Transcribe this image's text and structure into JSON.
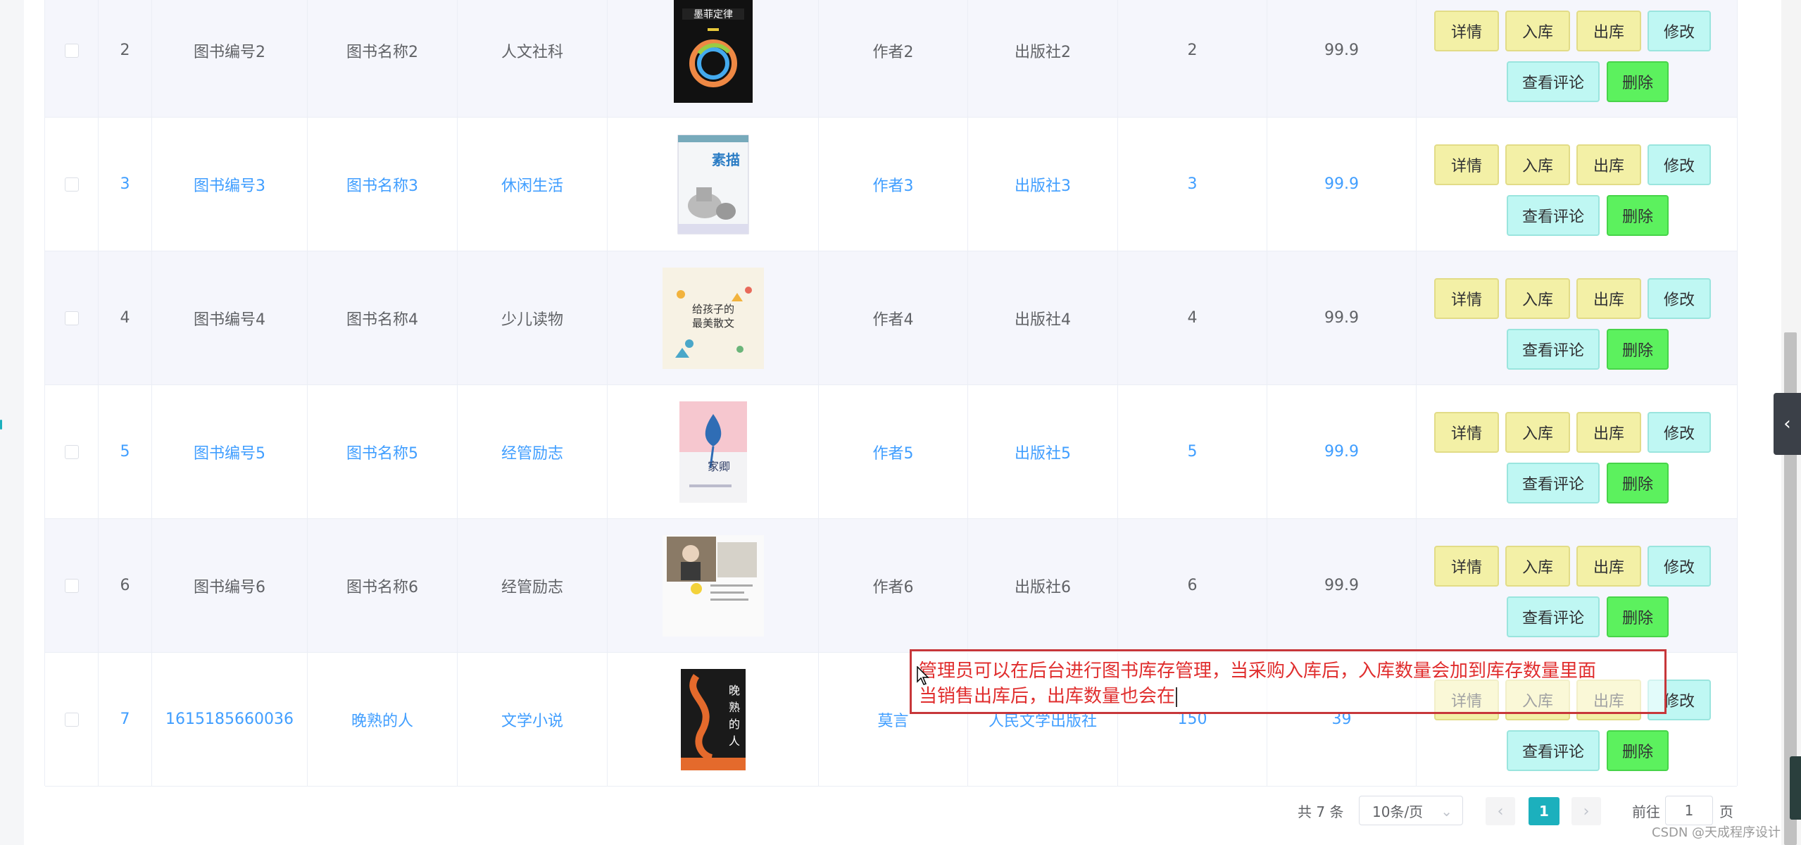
{
  "columns": [
    "checkbox",
    "index",
    "book_no",
    "book_name",
    "category",
    "cover",
    "author",
    "publisher",
    "quantity",
    "price",
    "actions"
  ],
  "actions": {
    "detail": "详情",
    "stock_in": "入库",
    "stock_out": "出库",
    "edit": "修改",
    "comments": "查看评论",
    "delete": "删除"
  },
  "rows": [
    {
      "index": "2",
      "book_no": "图书编号2",
      "book_name": "图书名称2",
      "category": "人文社科",
      "cover": "cover-moores-law",
      "cover_title": "墨菲定律",
      "author": "作者2",
      "publisher": "出版社2",
      "quantity": "2",
      "price": "99.9",
      "highlight": false
    },
    {
      "index": "3",
      "book_no": "图书编号3",
      "book_name": "图书名称3",
      "category": "休闲生活",
      "cover": "cover-sketch",
      "cover_title": "素描",
      "author": "作者3",
      "publisher": "出版社3",
      "quantity": "3",
      "price": "99.9",
      "highlight": true
    },
    {
      "index": "4",
      "book_no": "图书编号4",
      "book_name": "图书名称4",
      "category": "少儿读物",
      "cover": "cover-essays-for-children",
      "cover_title": "给孩子的最美散文",
      "author": "作者4",
      "publisher": "出版社4",
      "quantity": "4",
      "price": "99.9",
      "highlight": false
    },
    {
      "index": "5",
      "book_no": "图书编号5",
      "book_name": "图书名称5",
      "category": "经管励志",
      "cover": "cover-hometown",
      "cover_title": "家卿",
      "author": "作者5",
      "publisher": "出版社5",
      "quantity": "5",
      "price": "99.9",
      "highlight": true
    },
    {
      "index": "6",
      "book_no": "图书编号6",
      "book_name": "图书名称6",
      "category": "经管励志",
      "cover": "cover-photo-person",
      "cover_title": "",
      "author": "作者6",
      "publisher": "出版社6",
      "quantity": "6",
      "price": "99.9",
      "highlight": false
    },
    {
      "index": "7",
      "book_no": "1615185660036",
      "book_name": "晚熟的人",
      "category": "文学小说",
      "cover": "cover-late-bloomer",
      "cover_title": "晚熟的人",
      "author": "莫言",
      "publisher": "人民文学出版社",
      "quantity": "150",
      "price": "39",
      "highlight": true
    }
  ],
  "annotation": {
    "line1": "管理员可以在后台进行图书库存管理，当采购入库后，入库数量会加到库存数量里面",
    "line2": "当销售出库后，出库数量也会在"
  },
  "pagination": {
    "total_label": "共 7 条",
    "page_size": "10条/页",
    "current_page": "1",
    "goto_prefix": "前往",
    "goto_value": "1",
    "goto_suffix": "页"
  },
  "watermark": "CSDN @天成程序设计",
  "colors": {
    "accent": "#1cb0bd",
    "link_blue": "#409eff",
    "btn_yellow": "#f3f0a6",
    "btn_cyan": "#bff7f3",
    "btn_green": "#5cf15e",
    "annotation_red": "#c7373a"
  }
}
